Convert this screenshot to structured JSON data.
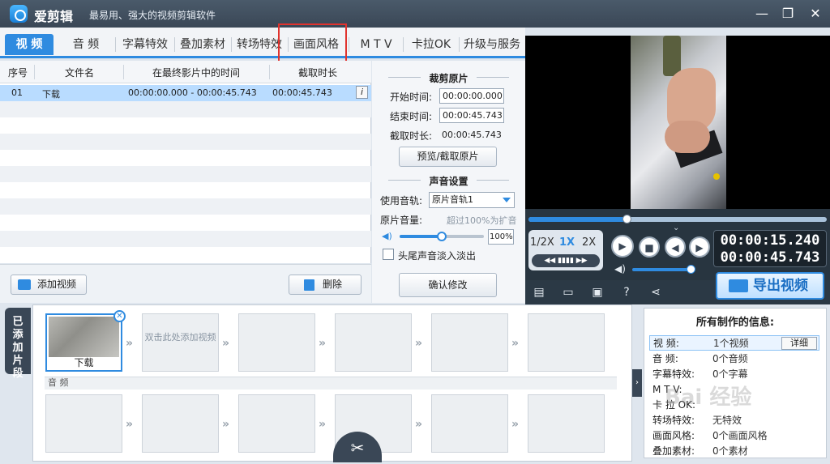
{
  "app": {
    "name": "爱剪辑",
    "slogan": "最易用、强大的视频剪辑软件",
    "window_controls": [
      "—",
      "❐",
      "✕"
    ]
  },
  "tabs": [
    "视 频",
    "音 频",
    "字幕特效",
    "叠加素材",
    "转场特效",
    "画面风格",
    "M T V",
    "卡拉OK",
    "升级与服务"
  ],
  "active_tab": "视 频",
  "clip_table": {
    "headers": [
      "序号",
      "文件名",
      "在最终影片中的时间",
      "截取时长"
    ],
    "rows": [
      {
        "index": "01",
        "name": "下载",
        "time": "00:00:00.000 - 00:00:45.743",
        "duration": "00:00:45.743",
        "info": "i"
      }
    ]
  },
  "clip_actions": {
    "add_video": "添加视频",
    "delete": "删除"
  },
  "trim": {
    "title": "裁剪原片",
    "start_label": "开始时间:",
    "start_value": "00:00:00.000",
    "end_label": "结束时间:",
    "end_value": "00:00:45.743",
    "duration_label": "截取时长:",
    "duration_value": "00:00:45.743",
    "preview_button": "预览/截取原片"
  },
  "sound": {
    "title": "声音设置",
    "track_label": "使用音轨:",
    "track_value": "原片音轨1",
    "volume_label": "原片音量:",
    "volume_hint": "超过100%为扩音",
    "volume_value": "100%",
    "volume_level": 0.5,
    "fade_label": "头尾声音淡入淡出",
    "confirm_button": "确认修改"
  },
  "player": {
    "progress": 0.33,
    "speeds": [
      "1/2X",
      "1X",
      "2X"
    ],
    "active_speed": "1X",
    "current_time": "00:00:15.240",
    "total_time": "00:00:45.743",
    "volume": 0.95
  },
  "toolbar": {
    "export_label": "导出视频"
  },
  "timeline": {
    "side_label": "已添加片段",
    "clip_label": "下载",
    "placeholder": "双击此处添加视频",
    "audio_label": "音 频"
  },
  "info": {
    "title": "所有制作的信息:",
    "detail_button": "详细",
    "rows": [
      {
        "key": "视 频:",
        "value": "1个视频"
      },
      {
        "key": "音 频:",
        "value": "0个音频"
      },
      {
        "key": "字幕特效:",
        "value": "0个字幕"
      },
      {
        "key": "M T V:",
        "value": ""
      },
      {
        "key": "卡 拉 OK:",
        "value": ""
      },
      {
        "key": "转场特效:",
        "value": "无特效"
      },
      {
        "key": "画面风格:",
        "value": "0个画面风格"
      },
      {
        "key": "叠加素材:",
        "value": "0个素材"
      }
    ]
  },
  "watermark": "Bai 经验"
}
